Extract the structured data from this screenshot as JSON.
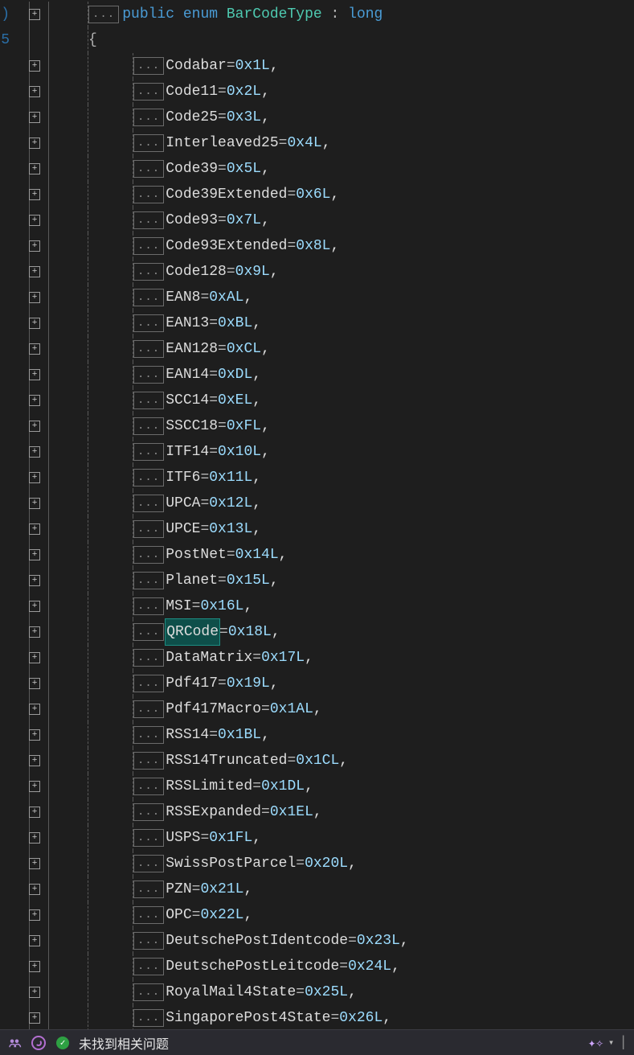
{
  "declaration": {
    "modifier": "public",
    "keyword": "enum",
    "name": "BarCodeType",
    "colon": ":",
    "base_type": "long"
  },
  "open_brace": "{",
  "collapse_marker": "...",
  "enum_members": [
    {
      "name": "Codabar",
      "value": "0x1L"
    },
    {
      "name": "Code11",
      "value": "0x2L"
    },
    {
      "name": "Code25",
      "value": "0x3L"
    },
    {
      "name": "Interleaved25",
      "value": "0x4L"
    },
    {
      "name": "Code39",
      "value": "0x5L"
    },
    {
      "name": "Code39Extended",
      "value": "0x6L"
    },
    {
      "name": "Code93",
      "value": "0x7L"
    },
    {
      "name": "Code93Extended",
      "value": "0x8L"
    },
    {
      "name": "Code128",
      "value": "0x9L"
    },
    {
      "name": "EAN8",
      "value": "0xAL"
    },
    {
      "name": "EAN13",
      "value": "0xBL"
    },
    {
      "name": "EAN128",
      "value": "0xCL"
    },
    {
      "name": "EAN14",
      "value": "0xDL"
    },
    {
      "name": "SCC14",
      "value": "0xEL"
    },
    {
      "name": "SSCC18",
      "value": "0xFL"
    },
    {
      "name": "ITF14",
      "value": "0x10L"
    },
    {
      "name": "ITF6",
      "value": "0x11L"
    },
    {
      "name": "UPCA",
      "value": "0x12L"
    },
    {
      "name": "UPCE",
      "value": "0x13L"
    },
    {
      "name": "PostNet",
      "value": "0x14L"
    },
    {
      "name": "Planet",
      "value": "0x15L"
    },
    {
      "name": "MSI",
      "value": "0x16L"
    },
    {
      "name": "QRCode",
      "value": "0x18L",
      "highlighted": true
    },
    {
      "name": "DataMatrix",
      "value": "0x17L"
    },
    {
      "name": "Pdf417",
      "value": "0x19L"
    },
    {
      "name": "Pdf417Macro",
      "value": "0x1AL"
    },
    {
      "name": "RSS14",
      "value": "0x1BL"
    },
    {
      "name": "RSS14Truncated",
      "value": "0x1CL"
    },
    {
      "name": "RSSLimited",
      "value": "0x1DL"
    },
    {
      "name": "RSSExpanded",
      "value": "0x1EL"
    },
    {
      "name": "USPS",
      "value": "0x1FL"
    },
    {
      "name": "SwissPostParcel",
      "value": "0x20L"
    },
    {
      "name": "PZN",
      "value": "0x21L"
    },
    {
      "name": "OPC",
      "value": "0x22L"
    },
    {
      "name": "DeutschePostIdentcode",
      "value": "0x23L"
    },
    {
      "name": "DeutschePostLeitcode",
      "value": "0x24L"
    },
    {
      "name": "RoyalMail4State",
      "value": "0x25L"
    },
    {
      "name": "SingaporePost4State",
      "value": "0x26L"
    }
  ],
  "statusbar": {
    "message": "未找到相关问题"
  }
}
